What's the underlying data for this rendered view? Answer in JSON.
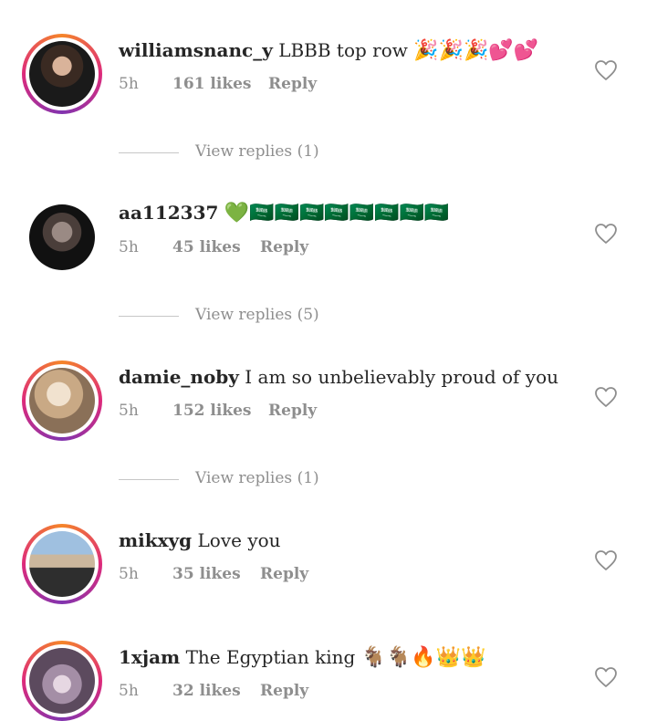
{
  "comments": [
    {
      "username": "williamsnanc_y",
      "text": "LBBB top row",
      "emoji": "🎉🎉🎉💕💕",
      "time": "5h",
      "likes": "161 likes",
      "reply": "Reply",
      "view_replies": "View replies (1)",
      "avatar_colors": [
        "#2b2b2b",
        "#6a4a3a"
      ]
    },
    {
      "username": "aa112337",
      "text": "",
      "emoji": "💚🇸🇦🇸🇦🇸🇦🇸🇦🇸🇦🇸🇦🇸🇦🇸🇦",
      "time": "5h",
      "likes": "45 likes",
      "reply": "Reply",
      "view_replies": "View replies (5)",
      "avatar_colors": [
        "#111111",
        "#6b5a52"
      ]
    },
    {
      "username": "damie_noby",
      "text": "I am so unbelievably proud of you",
      "emoji": "",
      "time": "5h",
      "likes": "152 likes",
      "reply": "Reply",
      "view_replies": "View replies (1)",
      "avatar_colors": [
        "#e9d9c4",
        "#b89a7c"
      ]
    },
    {
      "username": "mikxyg",
      "text": "Love you",
      "emoji": "",
      "time": "5h",
      "likes": "35 likes",
      "reply": "Reply",
      "view_replies": "",
      "avatar_colors": [
        "#8fb3d6",
        "#3a4a3a"
      ]
    },
    {
      "username": "1xjam",
      "text": "The Egyptian king",
      "emoji": "🐐🐐🔥👑👑",
      "time": "5h",
      "likes": "32 likes",
      "reply": "Reply",
      "view_replies": "",
      "avatar_colors": [
        "#b8a6b8",
        "#6e5c6e"
      ]
    }
  ],
  "colors": {
    "text": "#262626",
    "meta": "#8e8e8e",
    "ring_start": "#f58529",
    "ring_mid": "#dd2a7b",
    "ring_end": "#8134af"
  }
}
